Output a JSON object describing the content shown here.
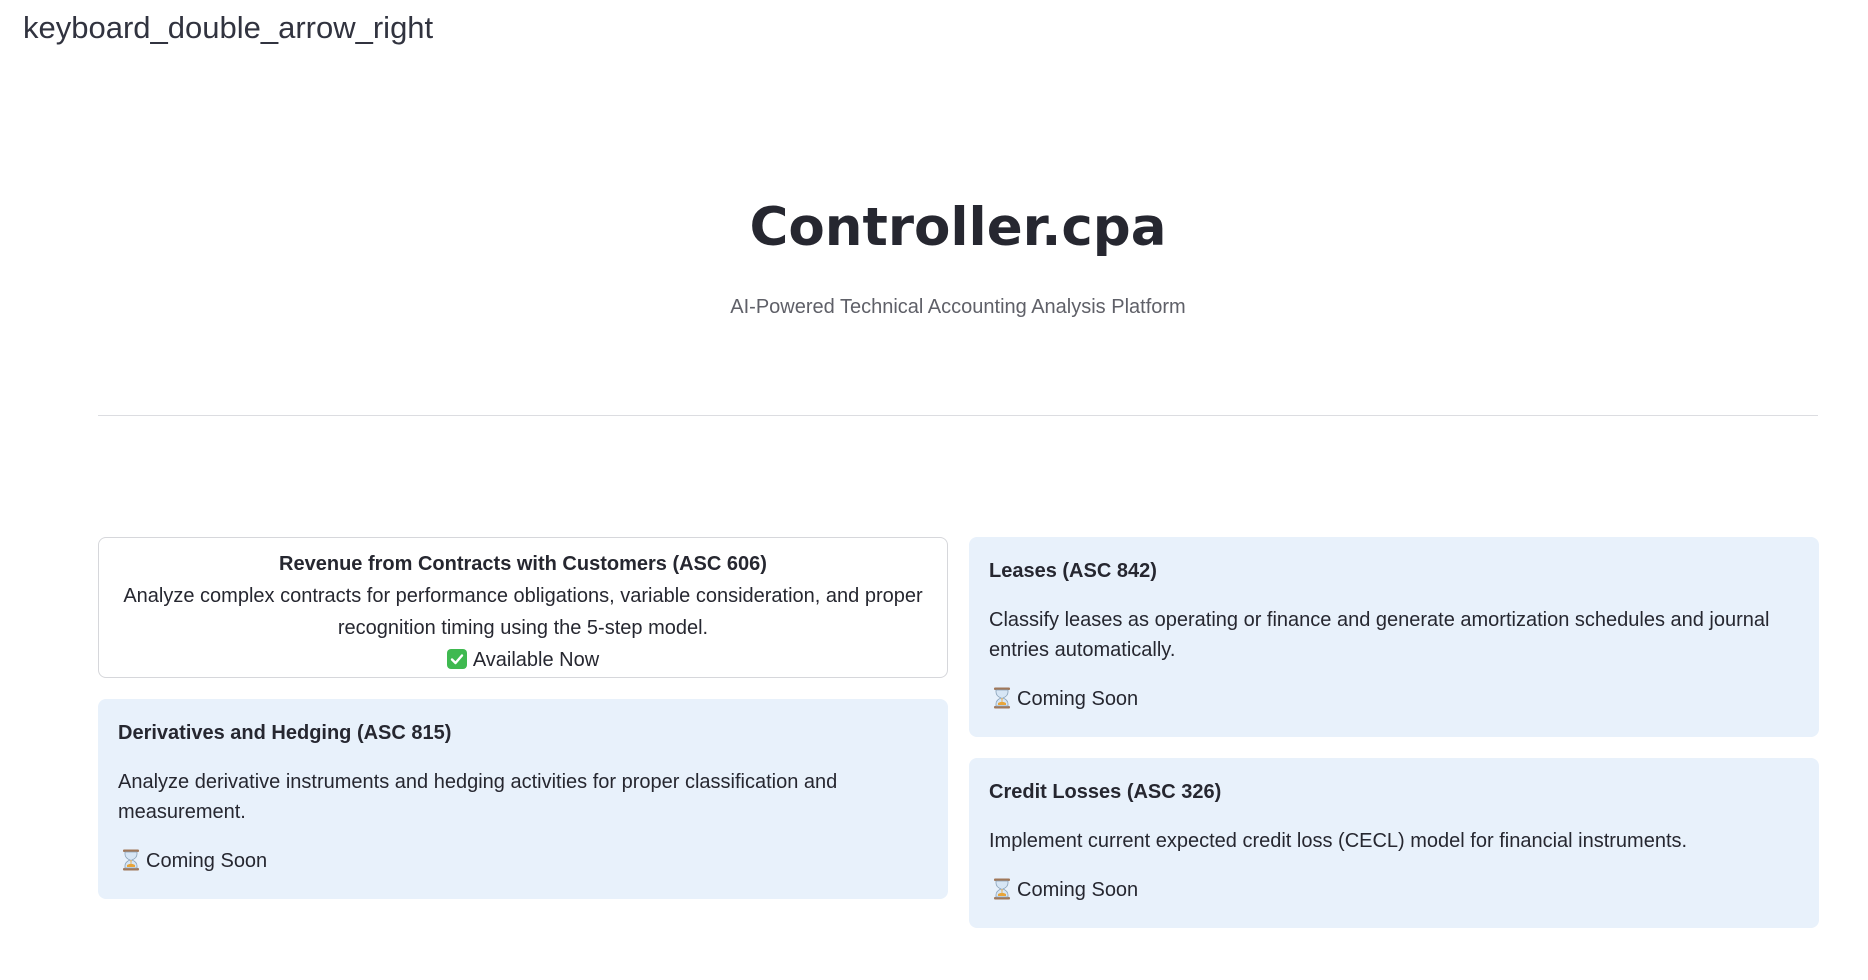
{
  "sidebar": {
    "toggle_label": "keyboard_double_arrow_right"
  },
  "hero": {
    "title": "Controller.cpa",
    "subtitle": "AI-Powered Technical Accounting Analysis Platform"
  },
  "cards": {
    "asc606": {
      "title": "Revenue from Contracts with Customers (ASC 606)",
      "description": "Analyze complex contracts for performance obligations, variable consideration, and proper recognition timing using the 5-step model.",
      "status": "Available Now",
      "status_icon": "check-icon"
    },
    "asc815": {
      "title": "Derivatives and Hedging (ASC 815)",
      "description": "Analyze derivative instruments and hedging activities for proper classification and measurement.",
      "status": "Coming Soon",
      "status_icon": "hourglass-icon"
    },
    "asc842": {
      "title": "Leases (ASC 842)",
      "description": "Classify leases as operating or finance and generate amortization schedules and journal entries automatically.",
      "status": "Coming Soon",
      "status_icon": "hourglass-icon"
    },
    "asc326": {
      "title": "Credit Losses (ASC 326)",
      "description": "Implement current expected credit loss (CECL) model for financial instruments.",
      "status": "Coming Soon",
      "status_icon": "hourglass-icon"
    }
  },
  "colors": {
    "card_soon_bg": "#e8f1fb",
    "check_green": "#3fb950",
    "text": "#262730",
    "subtitle": "#5f6068"
  }
}
